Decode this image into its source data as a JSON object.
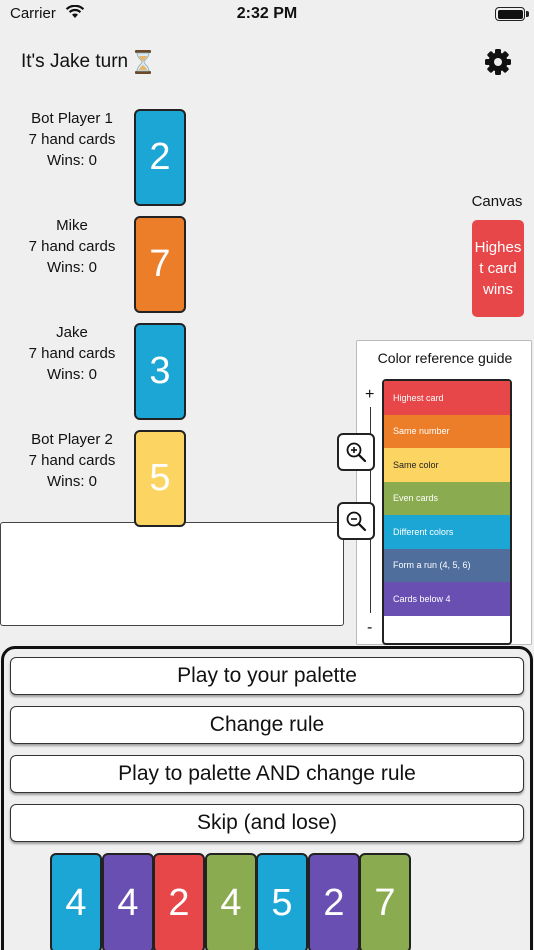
{
  "status": {
    "carrier": "Carrier",
    "time": "2:32 PM"
  },
  "header": {
    "turn_text": "It's Jake turn",
    "turn_icon": "hourglass-icon"
  },
  "players": [
    {
      "name": "Bot Player 1",
      "hand": "7 hand cards",
      "wins": "Wins: 0",
      "card": "2",
      "color": "#1ba6d5"
    },
    {
      "name": "Mike",
      "hand": "7 hand cards",
      "wins": "Wins: 0",
      "card": "7",
      "color": "#ec7e2a"
    },
    {
      "name": "Jake",
      "hand": "7 hand cards",
      "wins": "Wins: 0",
      "card": "3",
      "color": "#1ba6d5"
    },
    {
      "name": "Bot Player 2",
      "hand": "7 hand cards",
      "wins": "Wins: 0",
      "card": "5",
      "color": "#fcd462"
    }
  ],
  "canvas": {
    "label": "Canvas",
    "rule": "Highest card wins",
    "color": "#e8474a"
  },
  "guide": {
    "title": "Color reference guide",
    "plus": "+",
    "minus": "-",
    "rules": [
      {
        "label": "Highest card",
        "color": "#e8474a"
      },
      {
        "label": "Same number",
        "color": "#ec7e2a"
      },
      {
        "label": "Same color",
        "color": "#fcd462"
      },
      {
        "label": "Even cards",
        "color": "#8aab4f"
      },
      {
        "label": "Different colors",
        "color": "#1ba6d5"
      },
      {
        "label": "Form a run (4, 5, 6)",
        "color": "#4f6e9c"
      },
      {
        "label": "Cards below 4",
        "color": "#6a4fb3"
      }
    ]
  },
  "actions": {
    "play_palette": "Play to your palette",
    "change_rule": "Change rule",
    "play_and_change": "Play to palette AND change rule",
    "skip": "Skip (and lose)"
  },
  "hand": [
    {
      "value": "4",
      "color": "#1ba6d5"
    },
    {
      "value": "4",
      "color": "#6a4fb3"
    },
    {
      "value": "2",
      "color": "#e8474a"
    },
    {
      "value": "4",
      "color": "#8aab4f"
    },
    {
      "value": "5",
      "color": "#1ba6d5"
    },
    {
      "value": "2",
      "color": "#6a4fb3"
    },
    {
      "value": "7",
      "color": "#8aab4f"
    }
  ]
}
